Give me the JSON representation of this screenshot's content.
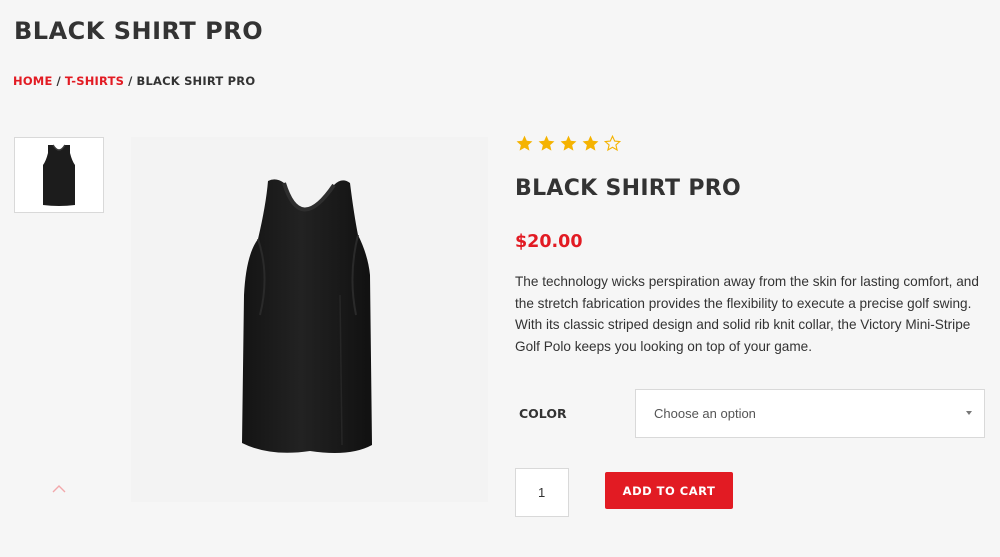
{
  "page": {
    "title": "BLACK SHIRT PRO"
  },
  "breadcrumb": {
    "home": "HOME",
    "separator": "/",
    "category": "T-SHIRTS",
    "current": "BLACK SHIRT PRO"
  },
  "gallery": {
    "thumbnail_icon": "tank-top-thumbnail",
    "main_icon": "tank-top-image",
    "nav_icon": "chevron-up-icon"
  },
  "product": {
    "rating": 4,
    "rating_max": 5,
    "title": "BLACK SHIRT PRO",
    "price": "$20.00",
    "description": "The technology wicks perspiration away from the skin for lasting comfort, and the stretch fabrication provides the flexibility to execute a precise golf swing. With its classic striped design and solid rib knit collar, the Victory Mini-Stripe Golf Polo keeps you looking on top of your game."
  },
  "variations": {
    "color_label": "COLOR",
    "color_placeholder": "Choose an option"
  },
  "cart": {
    "quantity": "1",
    "add_to_cart_label": "ADD TO CART"
  },
  "colors": {
    "accent": "#e21b23",
    "star": "#f5b301",
    "text": "#333333"
  }
}
